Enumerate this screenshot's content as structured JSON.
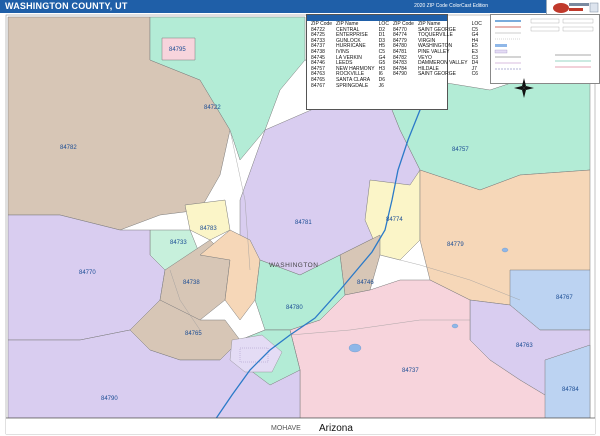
{
  "title": "WASHINGTON COUNTY, UT",
  "edition": "2020 ZIP Code ColorCast Edition",
  "zip_table": {
    "headers": [
      "ZIP Code",
      "ZIP Name",
      "LOC",
      "ZIP Code",
      "ZIP Name",
      "LOC"
    ],
    "rows": [
      [
        "84722",
        "CENTRAL",
        "D2",
        "84770",
        "SAINT GEORGE",
        "C5"
      ],
      [
        "84725",
        "ENTERPRISE",
        "D1",
        "84774",
        "TOQUERVILLE",
        "G4"
      ],
      [
        "84733",
        "GUNLOCK",
        "D3",
        "84779",
        "VIRGIN",
        "H4"
      ],
      [
        "84737",
        "HURRICANE",
        "H5",
        "84780",
        "WASHINGTON",
        "E5"
      ],
      [
        "84738",
        "IVINS",
        "C5",
        "84781",
        "PINE VALLEY",
        "E3"
      ],
      [
        "84745",
        "LA VERKIN",
        "G4",
        "84782",
        "VEYO",
        "C3"
      ],
      [
        "84746",
        "LEEDS",
        "G5",
        "84783",
        "DAMMERON VALLEY",
        "D4"
      ],
      [
        "84757",
        "NEW HARMONY",
        "H3",
        "84784",
        "HILDALE",
        "J7"
      ],
      [
        "84763",
        "ROCKVILLE",
        "I6",
        "84790",
        "SAINT GEORGE",
        "C6"
      ],
      [
        "84765",
        "SANTA CLARA",
        "D6",
        "",
        "",
        ""
      ],
      [
        "84767",
        "SPRINGDALE",
        "J6",
        "",
        "",
        ""
      ]
    ]
  },
  "zip_labels": [
    {
      "zip": "84795",
      "color": "#1a4c94"
    },
    {
      "zip": "84722",
      "color": "#1a4c94"
    },
    {
      "zip": "84782",
      "color": "#1a4c94"
    },
    {
      "zip": "84757",
      "color": "#1a4c94"
    },
    {
      "zip": "84781",
      "color": "#1a4c94"
    },
    {
      "zip": "84774",
      "color": "#1a4c94"
    },
    {
      "zip": "84783",
      "color": "#1a4c94"
    },
    {
      "zip": "84733",
      "color": "#1a4c94"
    },
    {
      "zip": "84770",
      "color": "#1a4c94"
    },
    {
      "zip": "84779",
      "color": "#1a4c94"
    },
    {
      "zip": "84738",
      "color": "#1a4c94"
    },
    {
      "zip": "84746",
      "color": "#1a4c94"
    },
    {
      "zip": "84780",
      "color": "#1a4c94"
    },
    {
      "zip": "84767",
      "color": "#1a4c94"
    },
    {
      "zip": "84765",
      "color": "#1a4c94"
    },
    {
      "zip": "84763",
      "color": "#1a4c94"
    },
    {
      "zip": "84737",
      "color": "#1a4c94"
    },
    {
      "zip": "84784",
      "color": "#1a4c94"
    },
    {
      "zip": "84790",
      "color": "#1a4c94"
    }
  ],
  "county_name": "WASHINGTON",
  "neighbor_county": "MOHAVE",
  "state_label": "Arizona",
  "colors": {
    "header": "#1f5fa8",
    "purple": "#d9cdf0",
    "lavender": "#e4dcf5",
    "green": "#b3ecd6",
    "mint": "#c7f0dc",
    "tan": "#d7c6b6",
    "peach": "#f6d7b8",
    "pink": "#f7d4dc",
    "yellow": "#fbf5c8",
    "blue": "#bcd3f2",
    "highway": "#2b7ac8",
    "boundary": "#666666"
  }
}
